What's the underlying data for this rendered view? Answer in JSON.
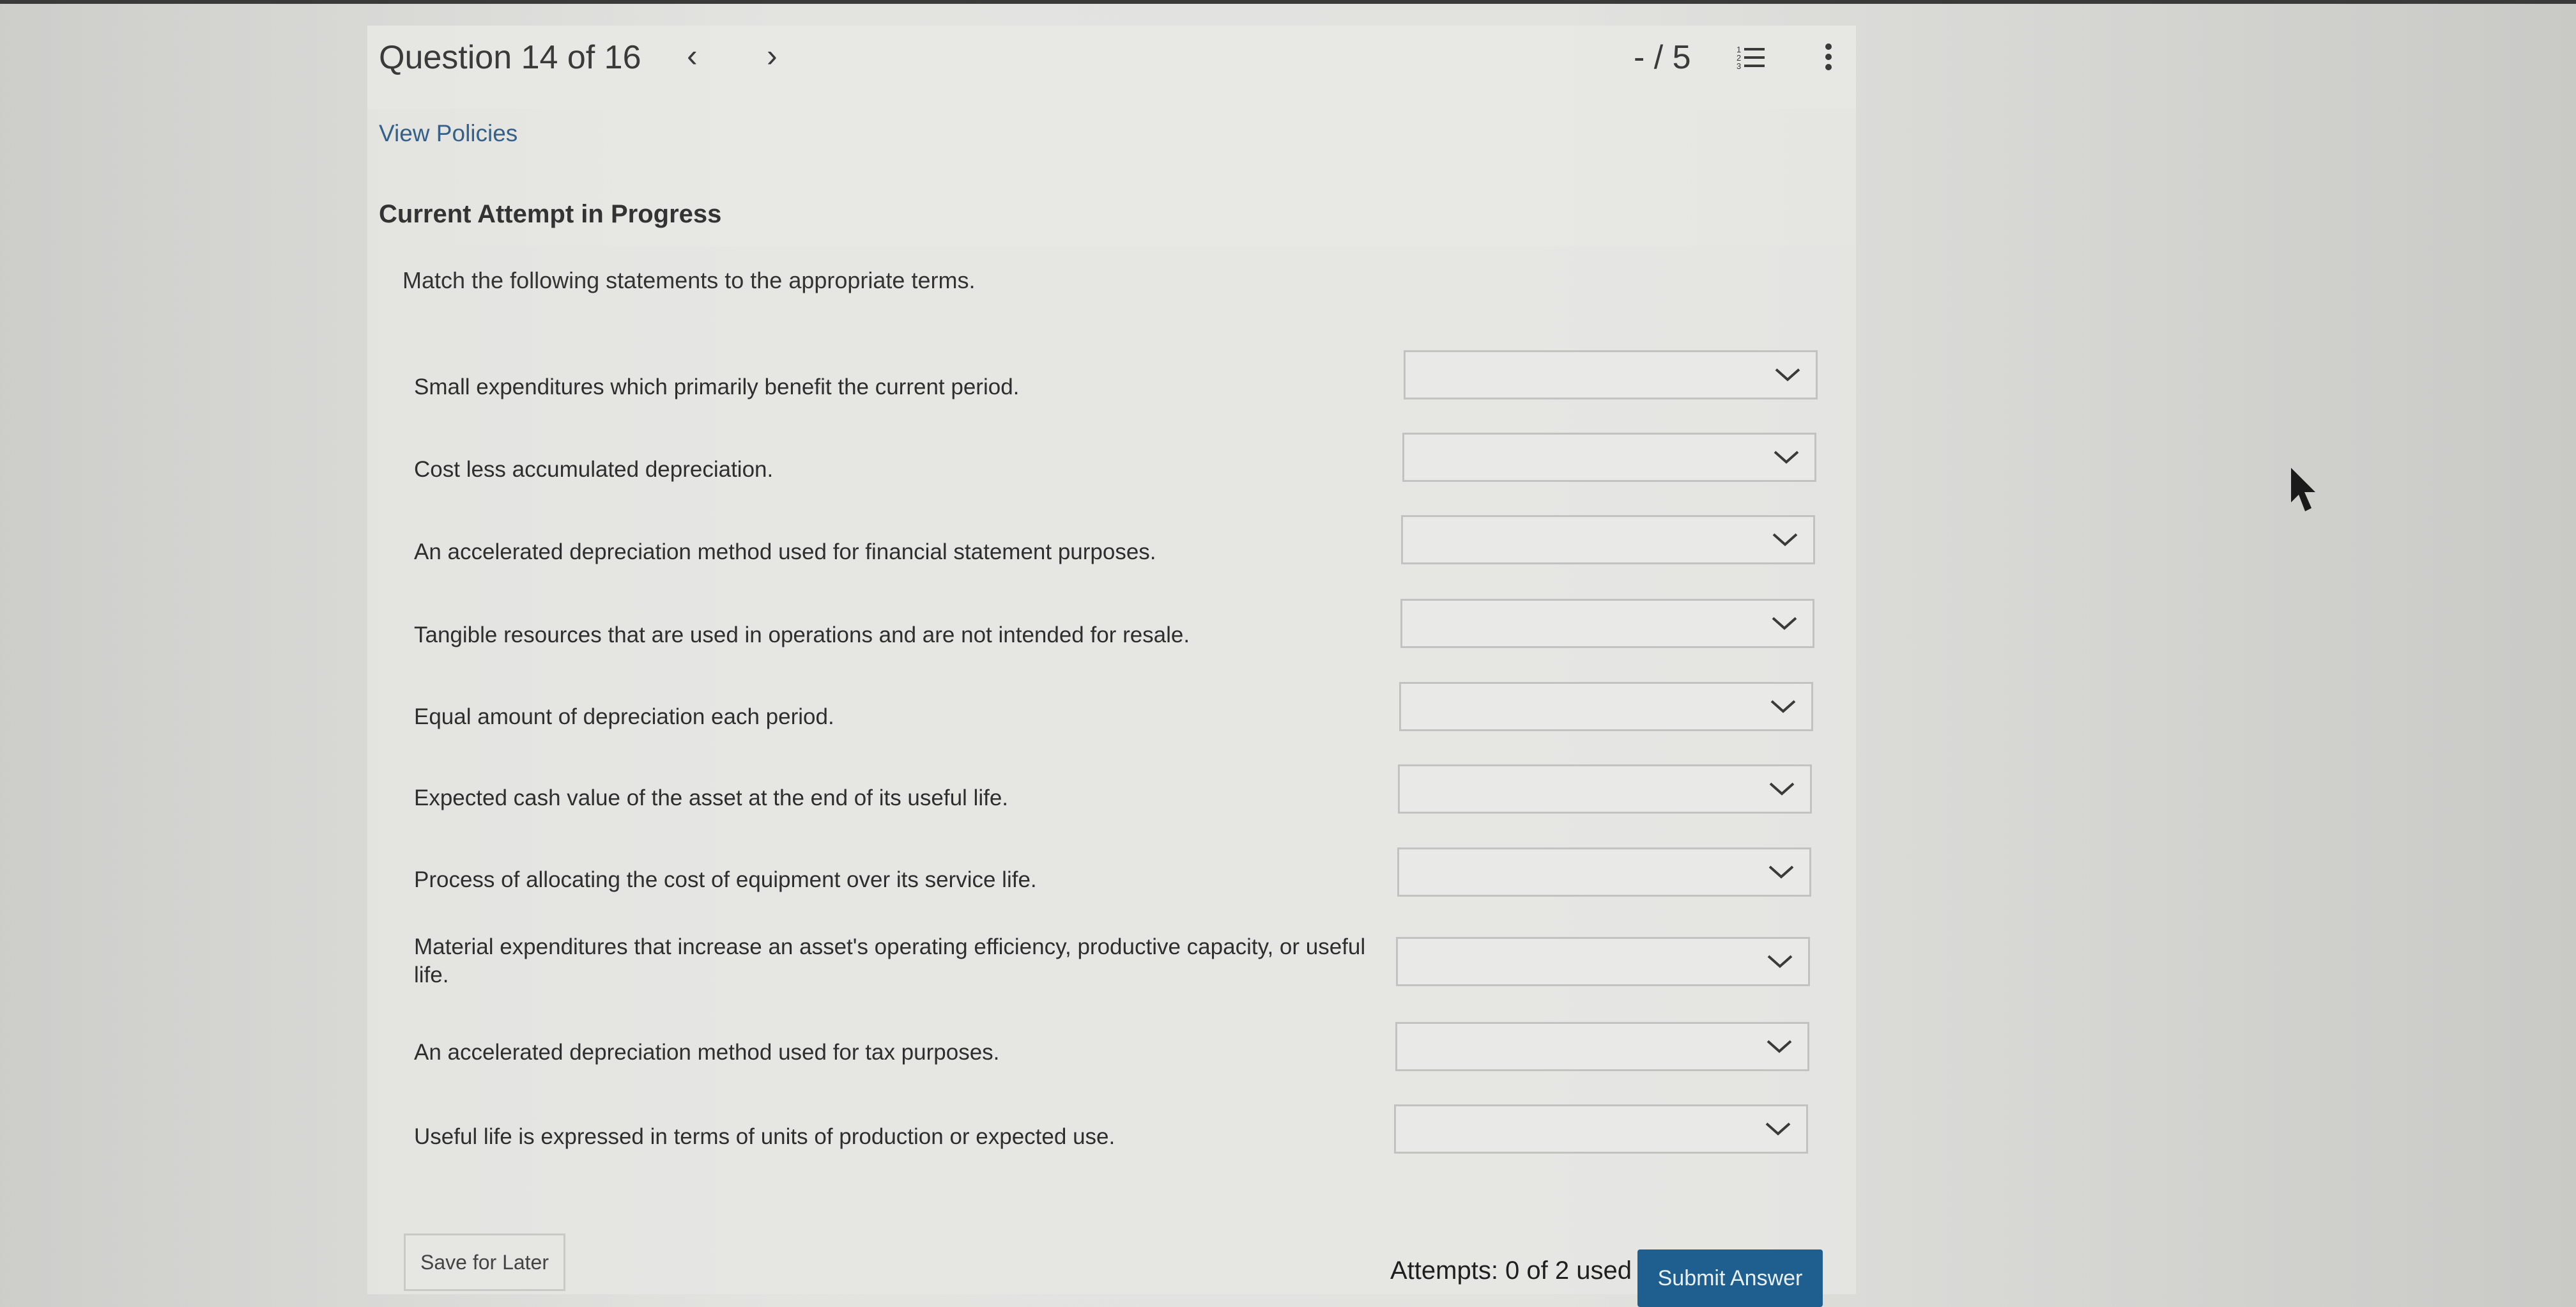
{
  "header": {
    "question_label": "Question 14 of 16",
    "prev_symbol": "‹",
    "next_symbol": "›",
    "score": "- / 5",
    "list_icon": "list-icon",
    "more_icon": "more-vertical-icon"
  },
  "links": {
    "view_policies": "View Policies"
  },
  "attempt": {
    "heading": "Current Attempt in Progress"
  },
  "question": {
    "instructions": "Match the following statements to the appropriate terms.",
    "items": [
      {
        "text": "Small expenditures which primarily benefit the current period.",
        "selected": ""
      },
      {
        "text": "Cost less accumulated depreciation.",
        "selected": ""
      },
      {
        "text": "An accelerated depreciation method used for financial statement purposes.",
        "selected": ""
      },
      {
        "text": "Tangible resources that are used in operations and are not intended for resale.",
        "selected": ""
      },
      {
        "text": "Equal amount of depreciation each period.",
        "selected": ""
      },
      {
        "text": "Expected cash value of the asset at the end of its useful life.",
        "selected": ""
      },
      {
        "text": "Process of allocating the cost of equipment over its service life.",
        "selected": ""
      },
      {
        "text": "Material expenditures that increase an asset's operating efficiency, productive capacity, or useful life.",
        "selected": ""
      },
      {
        "text": "An accelerated depreciation method used for tax purposes.",
        "selected": ""
      },
      {
        "text": "Useful life is expressed in terms of units of production or expected use.",
        "selected": ""
      }
    ]
  },
  "footer": {
    "save_label": "Save for Later",
    "attempts_text": "Attempts: 0 of 2 used",
    "submit_label": "Submit Answer"
  },
  "colors": {
    "link": "#34608a",
    "submit_bg": "#1f5f8f"
  }
}
